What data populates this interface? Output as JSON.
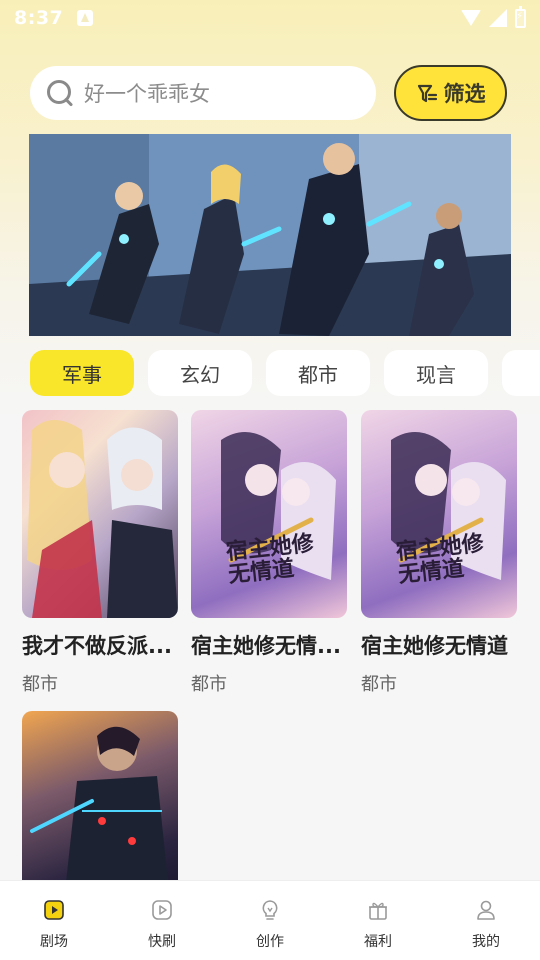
{
  "status_bar": {
    "time": "8:37"
  },
  "search": {
    "placeholder": "好一个乖乖女"
  },
  "filter": {
    "label": "筛选"
  },
  "tabs": [
    {
      "label": "军事",
      "active": true
    },
    {
      "label": "玄幻",
      "active": false
    },
    {
      "label": "都市",
      "active": false
    },
    {
      "label": "现言",
      "active": false
    },
    {
      "label": "二",
      "active": false
    }
  ],
  "cards": [
    {
      "title": "我才不做反派...",
      "genre": "都市"
    },
    {
      "title": "宿主她修无情...",
      "genre": "都市",
      "cover_text": "宿主她修无情道"
    },
    {
      "title": "宿主她修无情道",
      "genre": "都市",
      "cover_text": "宿主她修无情道"
    },
    {
      "title": "",
      "genre": ""
    }
  ],
  "bottom_nav": [
    {
      "label": "剧场",
      "icon": "play-square-icon",
      "active": true
    },
    {
      "label": "快刷",
      "icon": "play-circle-icon",
      "active": false
    },
    {
      "label": "创作",
      "icon": "lightbulb-icon",
      "active": false
    },
    {
      "label": "福利",
      "icon": "gift-icon",
      "active": false
    },
    {
      "label": "我的",
      "icon": "user-icon",
      "active": false
    }
  ],
  "colors": {
    "accent_yellow": "#ffe23a",
    "tab_active": "#f9e52a",
    "nav_active": "#f5d20f"
  }
}
